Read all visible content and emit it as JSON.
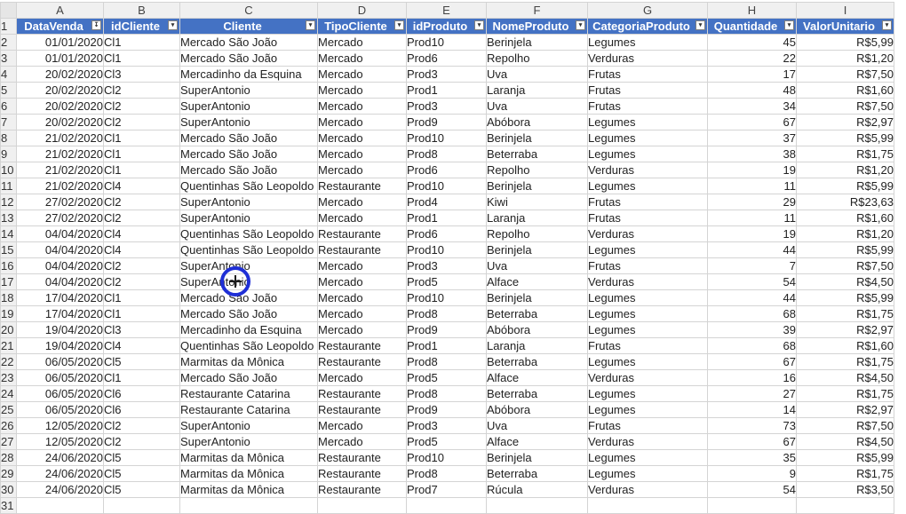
{
  "columns": [
    "A",
    "B",
    "C",
    "D",
    "E",
    "F",
    "G",
    "H",
    "I"
  ],
  "headers": [
    "DataVenda",
    "idCliente",
    "Cliente",
    "TipoCliente",
    "idProduto",
    "NomeProduto",
    "CategoriaProduto",
    "Quantidade",
    "ValorUnitario"
  ],
  "header_row_number": "1",
  "rows": [
    {
      "n": "2",
      "c": [
        "01/01/2020",
        "Cl1",
        "Mercado São João",
        "Mercado",
        "Prod10",
        "Berinjela",
        "Legumes",
        "45",
        "R$5,99"
      ]
    },
    {
      "n": "3",
      "c": [
        "01/01/2020",
        "Cl1",
        "Mercado São João",
        "Mercado",
        "Prod6",
        "Repolho",
        "Verduras",
        "22",
        "R$1,20"
      ]
    },
    {
      "n": "4",
      "c": [
        "20/02/2020",
        "Cl3",
        "Mercadinho da Esquina",
        "Mercado",
        "Prod3",
        "Uva",
        "Frutas",
        "17",
        "R$7,50"
      ]
    },
    {
      "n": "5",
      "c": [
        "20/02/2020",
        "Cl2",
        "SuperAntonio",
        "Mercado",
        "Prod1",
        "Laranja",
        "Frutas",
        "48",
        "R$1,60"
      ]
    },
    {
      "n": "6",
      "c": [
        "20/02/2020",
        "Cl2",
        "SuperAntonio",
        "Mercado",
        "Prod3",
        "Uva",
        "Frutas",
        "34",
        "R$7,50"
      ]
    },
    {
      "n": "7",
      "c": [
        "20/02/2020",
        "Cl2",
        "SuperAntonio",
        "Mercado",
        "Prod9",
        "Abóbora",
        "Legumes",
        "67",
        "R$2,97"
      ]
    },
    {
      "n": "8",
      "c": [
        "21/02/2020",
        "Cl1",
        "Mercado São João",
        "Mercado",
        "Prod10",
        "Berinjela",
        "Legumes",
        "37",
        "R$5,99"
      ]
    },
    {
      "n": "9",
      "c": [
        "21/02/2020",
        "Cl1",
        "Mercado São João",
        "Mercado",
        "Prod8",
        "Beterraba",
        "Legumes",
        "38",
        "R$1,75"
      ]
    },
    {
      "n": "10",
      "c": [
        "21/02/2020",
        "Cl1",
        "Mercado São João",
        "Mercado",
        "Prod6",
        "Repolho",
        "Verduras",
        "19",
        "R$1,20"
      ]
    },
    {
      "n": "11",
      "c": [
        "21/02/2020",
        "Cl4",
        "Quentinhas São Leopoldo",
        "Restaurante",
        "Prod10",
        "Berinjela",
        "Legumes",
        "11",
        "R$5,99"
      ]
    },
    {
      "n": "12",
      "c": [
        "27/02/2020",
        "Cl2",
        "SuperAntonio",
        "Mercado",
        "Prod4",
        "Kiwi",
        "Frutas",
        "29",
        "R$23,63"
      ]
    },
    {
      "n": "13",
      "c": [
        "27/02/2020",
        "Cl2",
        "SuperAntonio",
        "Mercado",
        "Prod1",
        "Laranja",
        "Frutas",
        "11",
        "R$1,60"
      ]
    },
    {
      "n": "14",
      "c": [
        "04/04/2020",
        "Cl4",
        "Quentinhas São Leopoldo",
        "Restaurante",
        "Prod6",
        "Repolho",
        "Verduras",
        "19",
        "R$1,20"
      ]
    },
    {
      "n": "15",
      "c": [
        "04/04/2020",
        "Cl4",
        "Quentinhas São Leopoldo",
        "Restaurante",
        "Prod10",
        "Berinjela",
        "Legumes",
        "44",
        "R$5,99"
      ]
    },
    {
      "n": "16",
      "c": [
        "04/04/2020",
        "Cl2",
        "SuperAntonio",
        "Mercado",
        "Prod3",
        "Uva",
        "Frutas",
        "7",
        "R$7,50"
      ]
    },
    {
      "n": "17",
      "c": [
        "04/04/2020",
        "Cl2",
        "SuperAntonio",
        "Mercado",
        "Prod5",
        "Alface",
        "Verduras",
        "54",
        "R$4,50"
      ]
    },
    {
      "n": "18",
      "c": [
        "17/04/2020",
        "Cl1",
        "Mercado São João",
        "Mercado",
        "Prod10",
        "Berinjela",
        "Legumes",
        "44",
        "R$5,99"
      ]
    },
    {
      "n": "19",
      "c": [
        "17/04/2020",
        "Cl1",
        "Mercado São João",
        "Mercado",
        "Prod8",
        "Beterraba",
        "Legumes",
        "68",
        "R$1,75"
      ]
    },
    {
      "n": "20",
      "c": [
        "19/04/2020",
        "Cl3",
        "Mercadinho da Esquina",
        "Mercado",
        "Prod9",
        "Abóbora",
        "Legumes",
        "39",
        "R$2,97"
      ]
    },
    {
      "n": "21",
      "c": [
        "19/04/2020",
        "Cl4",
        "Quentinhas São Leopoldo",
        "Restaurante",
        "Prod1",
        "Laranja",
        "Frutas",
        "68",
        "R$1,60"
      ]
    },
    {
      "n": "22",
      "c": [
        "06/05/2020",
        "Cl5",
        "Marmitas da Mônica",
        "Restaurante",
        "Prod8",
        "Beterraba",
        "Legumes",
        "67",
        "R$1,75"
      ]
    },
    {
      "n": "23",
      "c": [
        "06/05/2020",
        "Cl1",
        "Mercado São João",
        "Mercado",
        "Prod5",
        "Alface",
        "Verduras",
        "16",
        "R$4,50"
      ]
    },
    {
      "n": "24",
      "c": [
        "06/05/2020",
        "Cl6",
        "Restaurante Catarina",
        "Restaurante",
        "Prod8",
        "Beterraba",
        "Legumes",
        "27",
        "R$1,75"
      ]
    },
    {
      "n": "25",
      "c": [
        "06/05/2020",
        "Cl6",
        "Restaurante Catarina",
        "Restaurante",
        "Prod9",
        "Abóbora",
        "Legumes",
        "14",
        "R$2,97"
      ]
    },
    {
      "n": "26",
      "c": [
        "12/05/2020",
        "Cl2",
        "SuperAntonio",
        "Mercado",
        "Prod3",
        "Uva",
        "Frutas",
        "73",
        "R$7,50"
      ]
    },
    {
      "n": "27",
      "c": [
        "12/05/2020",
        "Cl2",
        "SuperAntonio",
        "Mercado",
        "Prod5",
        "Alface",
        "Verduras",
        "67",
        "R$4,50"
      ]
    },
    {
      "n": "28",
      "c": [
        "24/06/2020",
        "Cl5",
        "Marmitas da Mônica",
        "Restaurante",
        "Prod10",
        "Berinjela",
        "Legumes",
        "35",
        "R$5,99"
      ]
    },
    {
      "n": "29",
      "c": [
        "24/06/2020",
        "Cl5",
        "Marmitas da Mônica",
        "Restaurante",
        "Prod8",
        "Beterraba",
        "Legumes",
        "9",
        "R$1,75"
      ]
    },
    {
      "n": "30",
      "c": [
        "24/06/2020",
        "Cl5",
        "Marmitas da Mônica",
        "Restaurante",
        "Prod7",
        "Rúcula",
        "Verduras",
        "54",
        "R$3,50"
      ]
    }
  ],
  "empty_row_number": "31",
  "numeric_columns": [
    0,
    7,
    8
  ],
  "filter_icons": [
    "sort-desc-filter-icon",
    "filter-dropdown-icon",
    "filter-dropdown-icon",
    "filter-dropdown-icon",
    "filter-dropdown-icon",
    "filter-dropdown-icon",
    "filter-dropdown-icon",
    "filter-dropdown-icon",
    "filter-dropdown-icon"
  ],
  "accent_color": "#4472c4",
  "cursor_color": "#1f2fd6"
}
